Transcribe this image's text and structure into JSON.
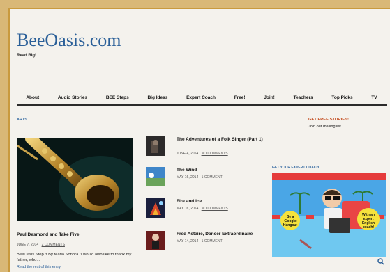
{
  "site": {
    "title": "BeeOasis.com",
    "tagline": "Read Big!"
  },
  "nav": {
    "items": [
      "About",
      "Audio Stories",
      "BEE Steps",
      "Big Ideas",
      "Expert Coach",
      "Free!",
      "Join!",
      "Teachers",
      "Top Picks",
      "TV"
    ]
  },
  "main": {
    "section_label": "ARTS",
    "featured": {
      "title": "Paul Desmond and Take Five",
      "date": "JUNE 7, 2014 ·",
      "comments": "2 COMMENTS",
      "excerpt": "BeeOasis Step 3 By Maria Sonora \"I would also like to thank my father, who...",
      "read_more": "Read the rest of this entry"
    },
    "posts": [
      {
        "title": "The Adventures of a Folk Singer (Part 1)",
        "date": "JUNE 4, 2014 ·",
        "comments": "NO COMMENTS"
      },
      {
        "title": "The Wind",
        "date": "MAY 16, 2014 ·",
        "comments": "1 COMMENT"
      },
      {
        "title": "Fire and Ice",
        "date": "MAY 16, 2014 ·",
        "comments": "NO COMMENTS"
      },
      {
        "title": "Fred Astaire, Dancer Extraordinaire",
        "date": "MAY 14, 2014 ·",
        "comments": "1 COMMENT"
      }
    ]
  },
  "sidebar": {
    "free_stories": "GET FREE STORIES!",
    "join_list": "Join our mailing list.",
    "coach_label": "GET YOUR EXPERT COACH",
    "ad_left": "Be a Google Hangout",
    "ad_right": "With an expert English coach!"
  },
  "colors": {
    "accent_blue": "#2a5f98",
    "accent_orange": "#c44a1c",
    "page_bg": "#f4f2ed",
    "nav_rule": "#2b2b2b"
  }
}
